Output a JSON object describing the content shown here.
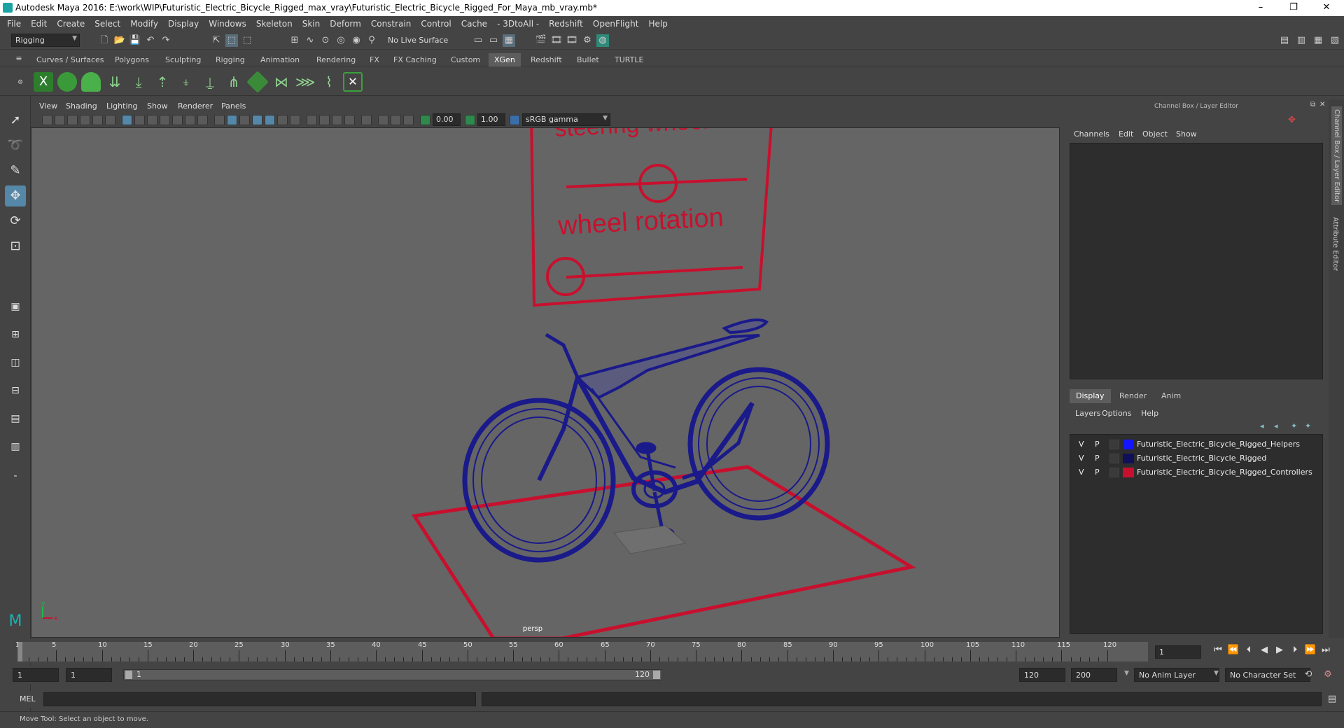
{
  "window": {
    "title": "Autodesk Maya 2016: E:\\work\\WIP\\Futuristic_Electric_Bicycle_Rigged_max_vray\\Futuristic_Electric_Bicycle_Rigged_For_Maya_mb_vray.mb*",
    "minimize": "–",
    "restore": "❐",
    "close": "✕"
  },
  "menubar": [
    "File",
    "Edit",
    "Create",
    "Select",
    "Modify",
    "Display",
    "Windows",
    "Skeleton",
    "Skin",
    "Deform",
    "Constrain",
    "Control",
    "Cache",
    "- 3DtoAll -",
    "Redshift",
    "OpenFlight",
    "Help"
  ],
  "status": {
    "menuset": "Rigging",
    "live_surface": "No Live Surface"
  },
  "shelf_tabs": [
    "Curves / Surfaces",
    "Polygons",
    "Sculpting",
    "Rigging",
    "Animation",
    "Rendering",
    "FX",
    "FX Caching",
    "Custom",
    "XGen",
    "Redshift",
    "Bullet",
    "TURTLE"
  ],
  "active_shelf": "XGen",
  "viewport": {
    "menus": [
      "View",
      "Shading",
      "Lighting",
      "Show",
      "Renderer",
      "Panels"
    ],
    "exposure": "0.00",
    "gamma": "1.00",
    "color_space": "sRGB gamma",
    "camera_label": "persp",
    "rig_label_1": "steering wheel",
    "rig_label_2": "wheel rotation",
    "axis_y": "y",
    "axis_x": "x"
  },
  "channel_box": {
    "header": "Channel Box / Layer Editor",
    "menus": [
      "Channels",
      "Edit",
      "Object",
      "Show"
    ]
  },
  "layer_editor": {
    "tabs": [
      "Display",
      "Render",
      "Anim"
    ],
    "active_tab": "Display",
    "menus": [
      "Layers",
      "Options",
      "Help"
    ],
    "layers": [
      {
        "v": "V",
        "p": "P",
        "name": "Futuristic_Electric_Bicycle_Rigged_Helpers",
        "color": "#1414ff"
      },
      {
        "v": "V",
        "p": "P",
        "name": "Futuristic_Electric_Bicycle_Rigged",
        "color": "#10105a"
      },
      {
        "v": "V",
        "p": "P",
        "name": "Futuristic_Electric_Bicycle_Rigged_Controllers",
        "color": "#c8102e"
      }
    ]
  },
  "side_tabs": [
    "Channel Box / Layer Editor",
    "Attribute Editor"
  ],
  "timeline": {
    "ticks": [
      "1",
      "5",
      "10",
      "15",
      "20",
      "25",
      "30",
      "35",
      "40",
      "45",
      "50",
      "55",
      "60",
      "65",
      "70",
      "75",
      "80",
      "85",
      "90",
      "95",
      "100",
      "105",
      "110",
      "115",
      "120"
    ],
    "current_frame": "1"
  },
  "range": {
    "start": "1",
    "playback_start": "1",
    "slider_start": "1",
    "slider_end": "120",
    "playback_end": "120",
    "end": "200",
    "anim_layer": "No Anim Layer",
    "character_set": "No Character Set"
  },
  "cmdline": {
    "label": "MEL"
  },
  "helpline": {
    "text": "Move Tool: Select an object to move."
  }
}
